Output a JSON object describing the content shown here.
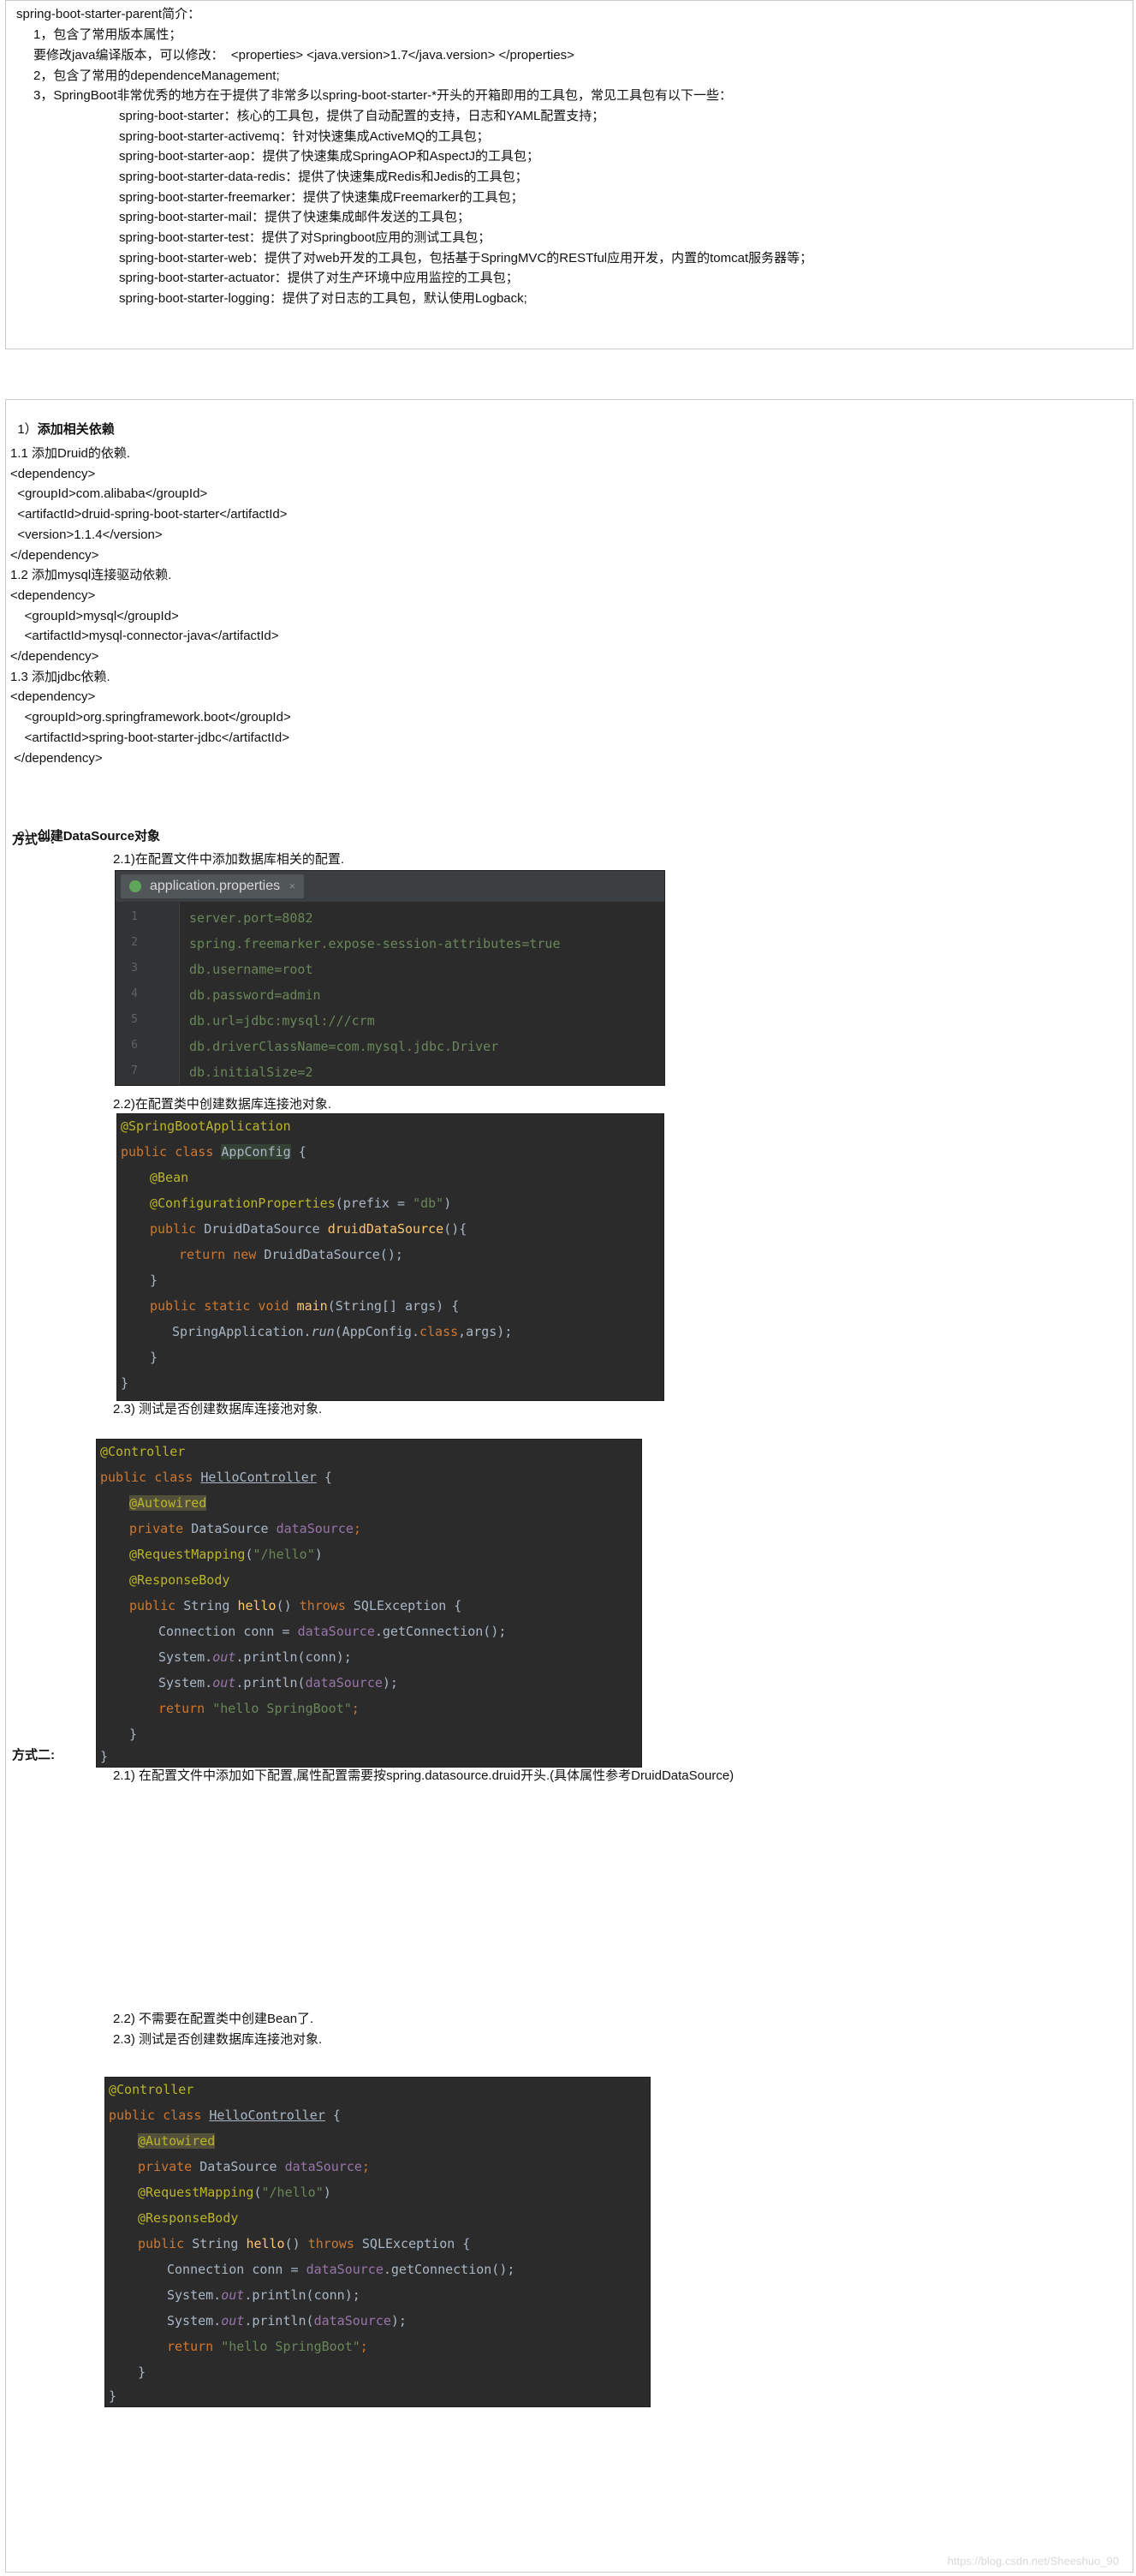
{
  "intro": {
    "title": "spring-boot-starter-parent简介：",
    "items": [
      "1，包含了常用版本属性；",
      "要修改java编译版本，可以修改：  <properties> <java.version>1.7</java.version> </properties>",
      "2，包含了常用的dependenceManagement;",
      "3，SpringBoot非常优秀的地方在于提供了非常多以spring-boot-starter-*开头的开箱即用的工具包，常见工具包有以下一些："
    ],
    "starters": [
      "spring-boot-starter：核心的工具包，提供了自动配置的支持，日志和YAML配置支持；",
      "spring-boot-starter-activemq：针对快速集成ActiveMQ的工具包；",
      "spring-boot-starter-aop：提供了快速集成SpringAOP和AspectJ的工具包；",
      "spring-boot-starter-data-redis：提供了快速集成Redis和Jedis的工具包；",
      "spring-boot-starter-freemarker：提供了快速集成Freemarker的工具包；",
      "spring-boot-starter-mail：提供了快速集成邮件发送的工具包；",
      "spring-boot-starter-test：提供了对Springboot应用的测试工具包；",
      "spring-boot-starter-web：提供了对web开发的工具包，包括基于SpringMVC的RESTful应用开发，内置的tomcat服务器等；",
      "spring-boot-starter-actuator：提供了对生产环境中应用监控的工具包；",
      "spring-boot-starter-logging：提供了对日志的工具包，默认使用Logback;"
    ]
  },
  "section1": {
    "heading_num": "1）",
    "heading": "添加相关依赖",
    "lines": [
      "1.1 添加Druid的依赖.",
      "<dependency>",
      "  <groupId>com.alibaba</groupId>",
      "  <artifactId>druid-spring-boot-starter</artifactId>",
      "  <version>1.1.4</version>",
      "</dependency>",
      "1.2 添加mysql连接驱动依赖.",
      "<dependency>",
      "    <groupId>mysql</groupId>",
      "    <artifactId>mysql-connector-java</artifactId>",
      "</dependency>",
      "1.3 添加jdbc依赖.",
      "<dependency>",
      "    <groupId>org.springframework.boot</groupId>",
      "    <artifactId>spring-boot-starter-jdbc</artifactId>",
      " </dependency>"
    ]
  },
  "section2": {
    "heading_num": "2）",
    "heading": "创建DataSource对象",
    "way1": "方式一:",
    "step21": "2.1)在配置文件中添加数据库相关的配置.",
    "step22": "2.2)在配置类中创建数据库连接池对象.",
    "step23": "2.3) 测试是否创建数据库连接池对象.",
    "way2": "方式二:",
    "way2_step21": "2.1) 在配置文件中添加如下配置,属性配置需要按spring.datasource.druid开头.(具体属性参考DruidDataSource)",
    "way2_step22": "2.2) 不需要在配置类中创建Bean了.",
    "way2_step23": "2.3) 测试是否创建数据库连接池对象."
  },
  "props_editor": {
    "tab": "application.properties",
    "close": "×",
    "line_numbers": [
      "1",
      "2",
      "3",
      "4",
      "5",
      "6",
      "7"
    ],
    "lines": [
      "server.port=8082",
      "spring.freemarker.expose-session-attributes=true",
      "db.username=root",
      "db.password=admin",
      "db.url=jdbc:mysql:///crm",
      "db.driverClassName=com.mysql.jdbc.Driver",
      "db.initialSize=2"
    ]
  },
  "appconfig_code": {
    "l1": "@SpringBootApplication",
    "l2_kw": "public class ",
    "l2_name": "AppConfig",
    "l2_end": " {",
    "l3": "@Bean",
    "l4_an": "@ConfigurationProperties",
    "l4_a": "(",
    "l4_b": "prefix",
    "l4_c": " = ",
    "l4_str": "\"db\"",
    "l4_d": ")",
    "l5_kw": "public ",
    "l5_type": "DruidDataSource ",
    "l5_fn": "druidDataSource",
    "l5_end": "(){",
    "l6_kw": "return new ",
    "l6_end": "DruidDataSource();",
    "l7": "}",
    "l8_kw": "public static void ",
    "l8_fn": "main",
    "l8_end": "(String[] args) {",
    "l9_a": "SpringApplication.",
    "l9_b": "run",
    "l9_c": "(AppConfig.",
    "l9_kw": "class",
    "l9_d": ",args);",
    "l10": "}",
    "l11": "}"
  },
  "controller_code": {
    "l1": "@Controller",
    "l2_kw": "public class ",
    "l2_name": "HelloController",
    "l2_end": " {",
    "l3": "@Autowired",
    "l4_kw": "private ",
    "l4_type": "DataSource ",
    "l4_fld": "dataSource",
    "l4_end": ";",
    "l5_an": "@RequestMapping",
    "l5_a": "(",
    "l5_str": "\"/hello\"",
    "l5_b": ")",
    "l6": "@ResponseBody",
    "l7_kw": "public ",
    "l7_type": "String ",
    "l7_fn": "hello",
    "l7_a": "() ",
    "l7_kw2": "throws ",
    "l7_end": "SQLException {",
    "l8_a": "Connection conn = ",
    "l8_fld": "dataSource",
    "l8_b": ".getConnection();",
    "l9_a": "System.",
    "l9_out": "out",
    "l9_b": ".println(conn);",
    "l10_a": "System.",
    "l10_out": "out",
    "l10_b": ".println(",
    "l10_fld": "dataSource",
    "l10_c": ");",
    "l11_kw": "return ",
    "l11_str": "\"hello SpringBoot\"",
    "l11_end": ";",
    "l12": "}",
    "l13": "}"
  },
  "watermark": "https://blog.csdn.net/Sheeshuo_90"
}
